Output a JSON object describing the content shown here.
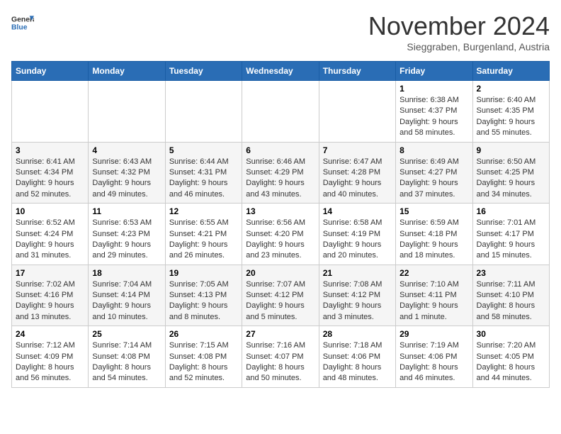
{
  "logo": {
    "general": "General",
    "blue": "Blue"
  },
  "header": {
    "month": "November 2024",
    "location": "Sieggraben, Burgenland, Austria"
  },
  "weekdays": [
    "Sunday",
    "Monday",
    "Tuesday",
    "Wednesday",
    "Thursday",
    "Friday",
    "Saturday"
  ],
  "weeks": [
    [
      {
        "day": "",
        "info": ""
      },
      {
        "day": "",
        "info": ""
      },
      {
        "day": "",
        "info": ""
      },
      {
        "day": "",
        "info": ""
      },
      {
        "day": "",
        "info": ""
      },
      {
        "day": "1",
        "info": "Sunrise: 6:38 AM\nSunset: 4:37 PM\nDaylight: 9 hours\nand 58 minutes."
      },
      {
        "day": "2",
        "info": "Sunrise: 6:40 AM\nSunset: 4:35 PM\nDaylight: 9 hours\nand 55 minutes."
      }
    ],
    [
      {
        "day": "3",
        "info": "Sunrise: 6:41 AM\nSunset: 4:34 PM\nDaylight: 9 hours\nand 52 minutes."
      },
      {
        "day": "4",
        "info": "Sunrise: 6:43 AM\nSunset: 4:32 PM\nDaylight: 9 hours\nand 49 minutes."
      },
      {
        "day": "5",
        "info": "Sunrise: 6:44 AM\nSunset: 4:31 PM\nDaylight: 9 hours\nand 46 minutes."
      },
      {
        "day": "6",
        "info": "Sunrise: 6:46 AM\nSunset: 4:29 PM\nDaylight: 9 hours\nand 43 minutes."
      },
      {
        "day": "7",
        "info": "Sunrise: 6:47 AM\nSunset: 4:28 PM\nDaylight: 9 hours\nand 40 minutes."
      },
      {
        "day": "8",
        "info": "Sunrise: 6:49 AM\nSunset: 4:27 PM\nDaylight: 9 hours\nand 37 minutes."
      },
      {
        "day": "9",
        "info": "Sunrise: 6:50 AM\nSunset: 4:25 PM\nDaylight: 9 hours\nand 34 minutes."
      }
    ],
    [
      {
        "day": "10",
        "info": "Sunrise: 6:52 AM\nSunset: 4:24 PM\nDaylight: 9 hours\nand 31 minutes."
      },
      {
        "day": "11",
        "info": "Sunrise: 6:53 AM\nSunset: 4:23 PM\nDaylight: 9 hours\nand 29 minutes."
      },
      {
        "day": "12",
        "info": "Sunrise: 6:55 AM\nSunset: 4:21 PM\nDaylight: 9 hours\nand 26 minutes."
      },
      {
        "day": "13",
        "info": "Sunrise: 6:56 AM\nSunset: 4:20 PM\nDaylight: 9 hours\nand 23 minutes."
      },
      {
        "day": "14",
        "info": "Sunrise: 6:58 AM\nSunset: 4:19 PM\nDaylight: 9 hours\nand 20 minutes."
      },
      {
        "day": "15",
        "info": "Sunrise: 6:59 AM\nSunset: 4:18 PM\nDaylight: 9 hours\nand 18 minutes."
      },
      {
        "day": "16",
        "info": "Sunrise: 7:01 AM\nSunset: 4:17 PM\nDaylight: 9 hours\nand 15 minutes."
      }
    ],
    [
      {
        "day": "17",
        "info": "Sunrise: 7:02 AM\nSunset: 4:16 PM\nDaylight: 9 hours\nand 13 minutes."
      },
      {
        "day": "18",
        "info": "Sunrise: 7:04 AM\nSunset: 4:14 PM\nDaylight: 9 hours\nand 10 minutes."
      },
      {
        "day": "19",
        "info": "Sunrise: 7:05 AM\nSunset: 4:13 PM\nDaylight: 9 hours\nand 8 minutes."
      },
      {
        "day": "20",
        "info": "Sunrise: 7:07 AM\nSunset: 4:12 PM\nDaylight: 9 hours\nand 5 minutes."
      },
      {
        "day": "21",
        "info": "Sunrise: 7:08 AM\nSunset: 4:12 PM\nDaylight: 9 hours\nand 3 minutes."
      },
      {
        "day": "22",
        "info": "Sunrise: 7:10 AM\nSunset: 4:11 PM\nDaylight: 9 hours\nand 1 minute."
      },
      {
        "day": "23",
        "info": "Sunrise: 7:11 AM\nSunset: 4:10 PM\nDaylight: 8 hours\nand 58 minutes."
      }
    ],
    [
      {
        "day": "24",
        "info": "Sunrise: 7:12 AM\nSunset: 4:09 PM\nDaylight: 8 hours\nand 56 minutes."
      },
      {
        "day": "25",
        "info": "Sunrise: 7:14 AM\nSunset: 4:08 PM\nDaylight: 8 hours\nand 54 minutes."
      },
      {
        "day": "26",
        "info": "Sunrise: 7:15 AM\nSunset: 4:08 PM\nDaylight: 8 hours\nand 52 minutes."
      },
      {
        "day": "27",
        "info": "Sunrise: 7:16 AM\nSunset: 4:07 PM\nDaylight: 8 hours\nand 50 minutes."
      },
      {
        "day": "28",
        "info": "Sunrise: 7:18 AM\nSunset: 4:06 PM\nDaylight: 8 hours\nand 48 minutes."
      },
      {
        "day": "29",
        "info": "Sunrise: 7:19 AM\nSunset: 4:06 PM\nDaylight: 8 hours\nand 46 minutes."
      },
      {
        "day": "30",
        "info": "Sunrise: 7:20 AM\nSunset: 4:05 PM\nDaylight: 8 hours\nand 44 minutes."
      }
    ]
  ]
}
